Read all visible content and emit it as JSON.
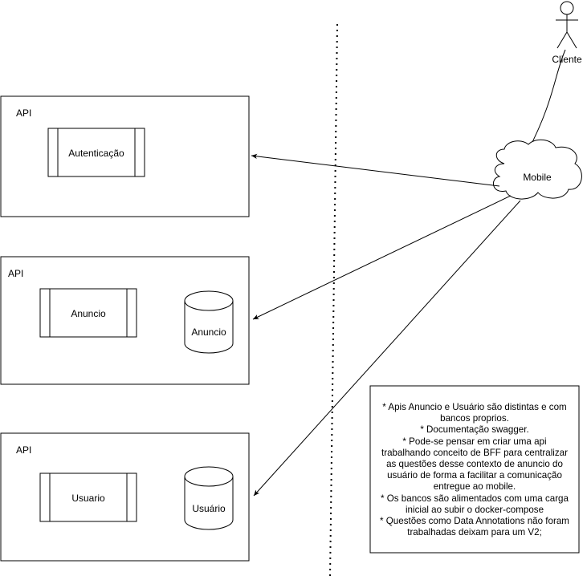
{
  "actor": {
    "label": "Cliente"
  },
  "mobile": {
    "label": "Mobile"
  },
  "apis": [
    {
      "title": "API",
      "service": "Autenticação"
    },
    {
      "title": "API",
      "service": "Anuncio",
      "database": "Anuncio"
    },
    {
      "title": "API",
      "service": "Usuario",
      "database": "Usuário"
    }
  ],
  "notes": {
    "lines": [
      "* Apis Anuncio e Usuário são  distintas e com",
      "bancos proprios.",
      "* Documentação swagger.",
      "* Pode-se pensar em criar uma api",
      "trabalhando conceito de BFF para centralizar",
      "as questões desse contexto de anuncio do",
      "usuário de forma a facilitar a comunicação",
      "entregue ao mobile.",
      "* Os bancos são alimentados com uma carga",
      "inicial ao subir o docker-compose",
      "* Questões como Data Annotations não foram",
      "trabalhadas deixam para um V2;"
    ]
  },
  "colors": {
    "stroke": "#000000",
    "background": "#ffffff"
  }
}
